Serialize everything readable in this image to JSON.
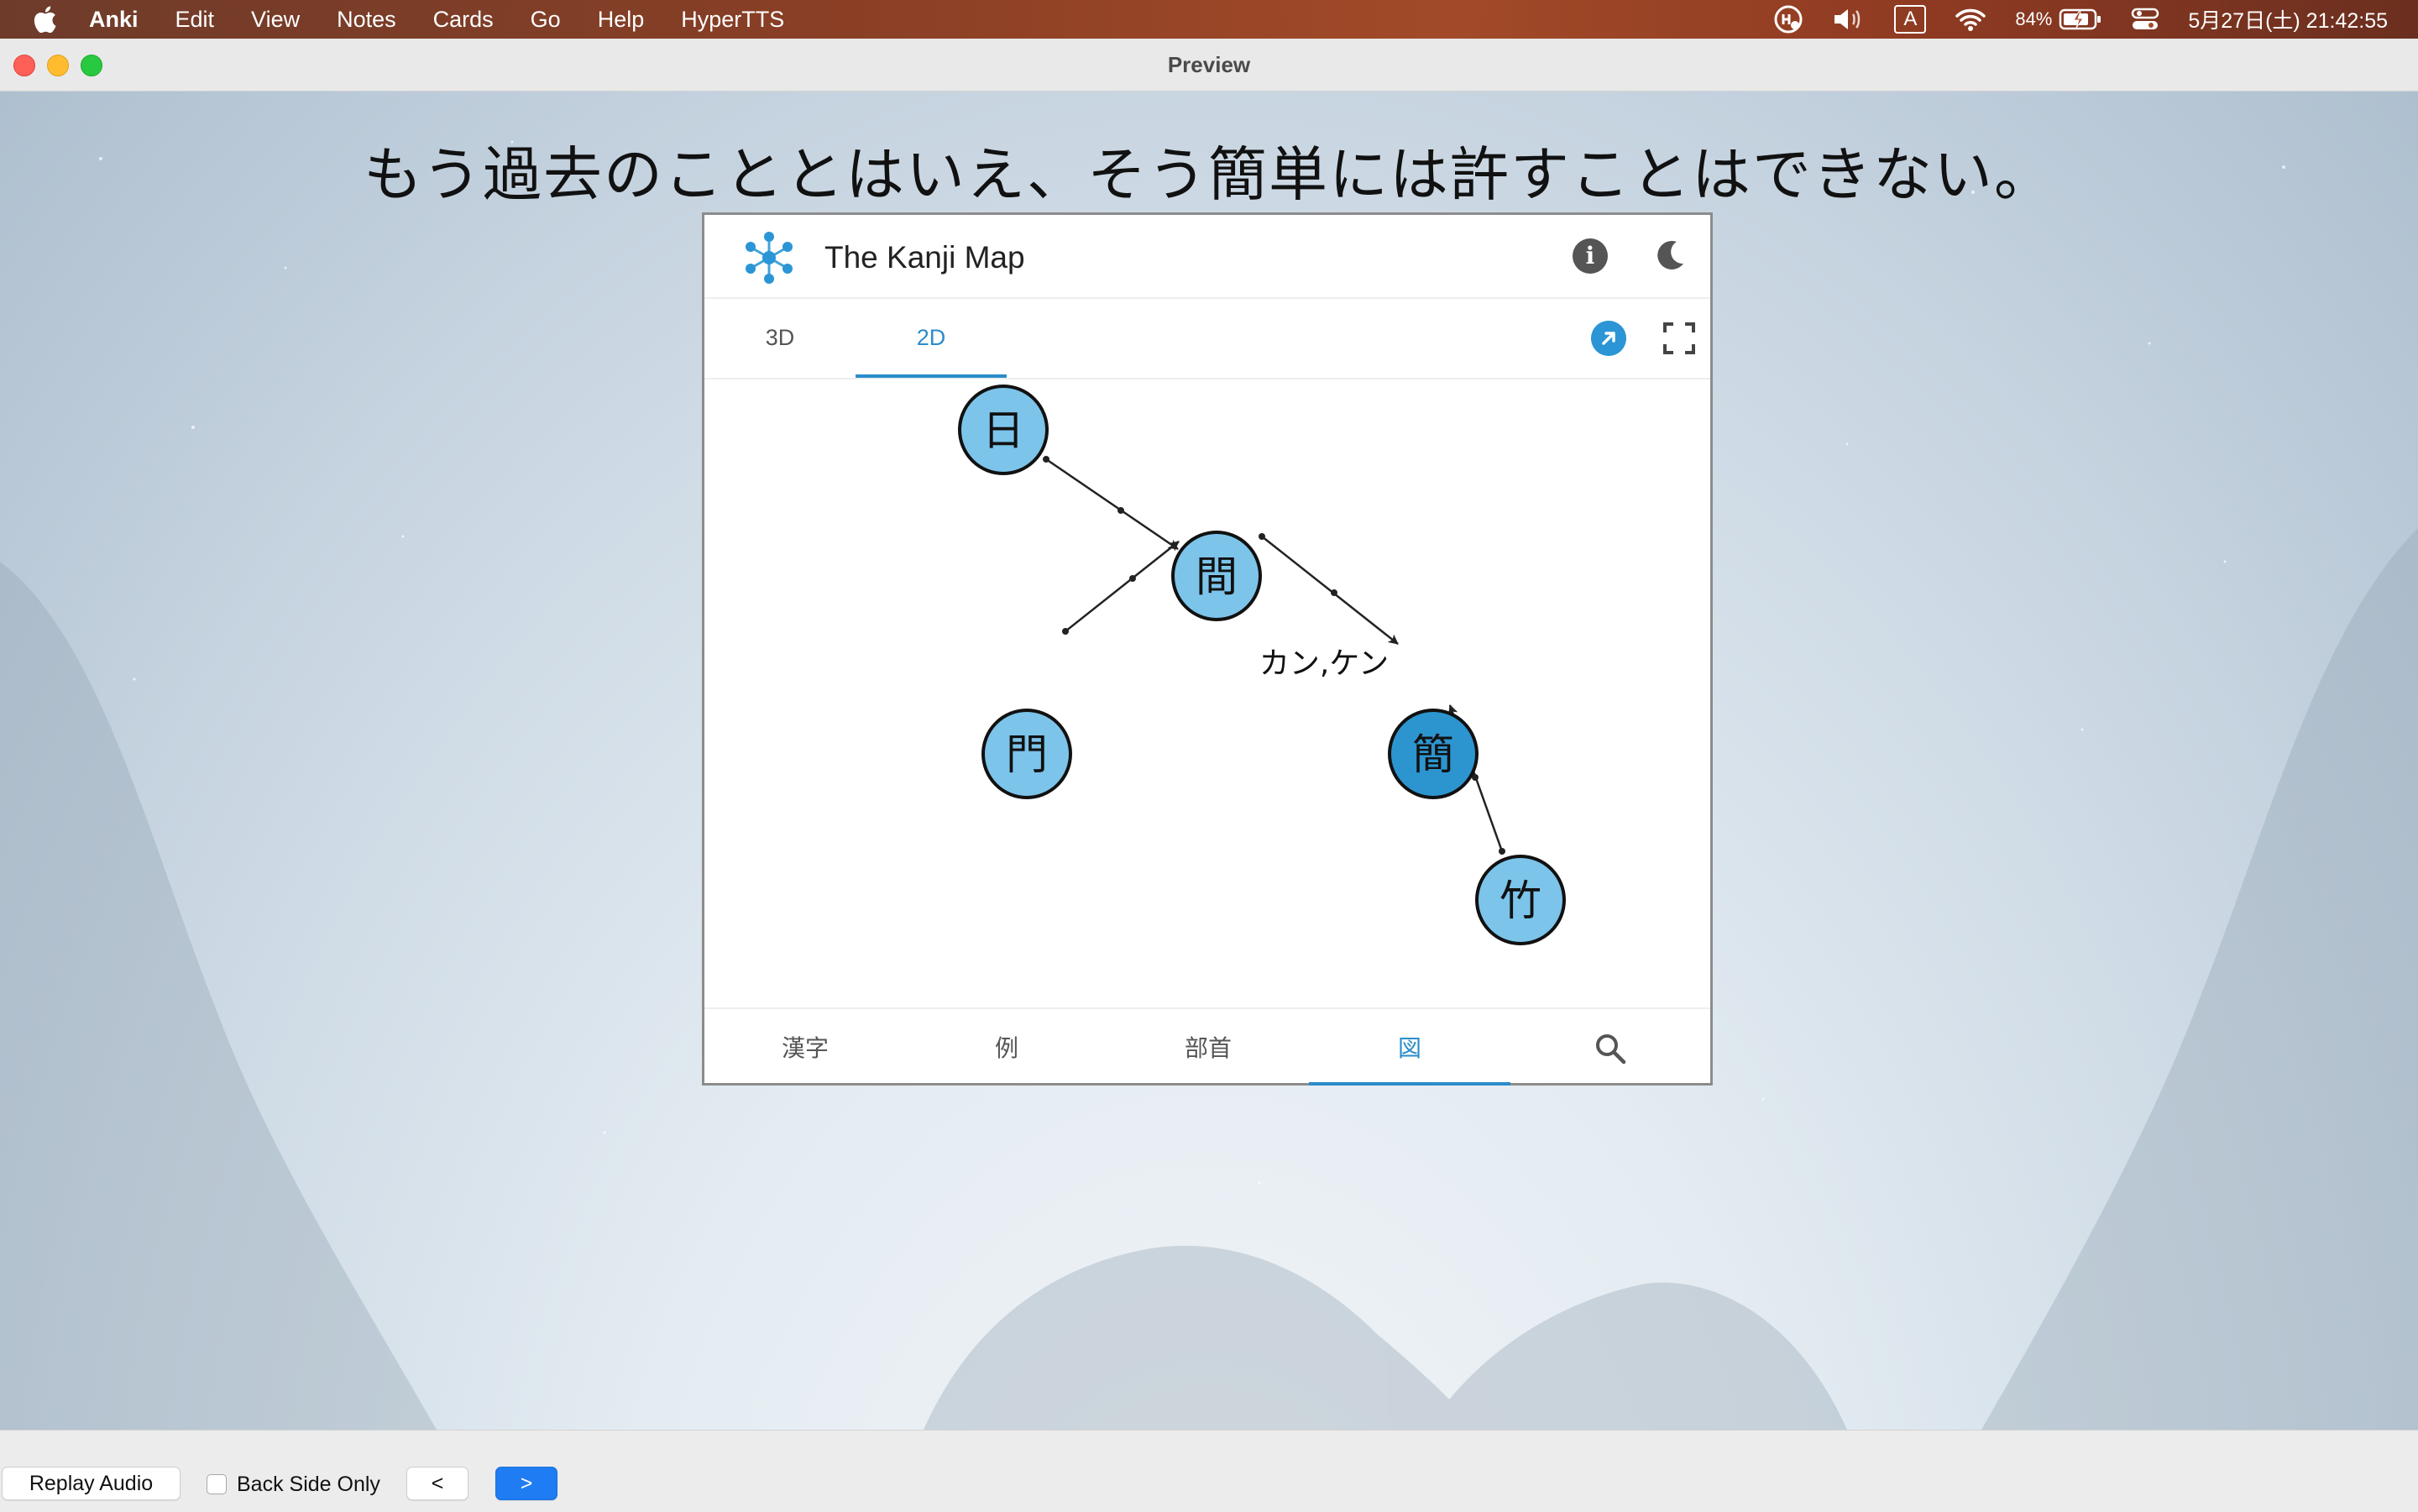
{
  "menubar": {
    "app_name": "Anki",
    "items": [
      "Edit",
      "View",
      "Notes",
      "Cards",
      "Go",
      "Help",
      "HyperTTS"
    ],
    "input_source": "A",
    "battery": "84%",
    "datetime": "5月27日(土) 21:42:55",
    "icons": [
      "apple-icon",
      "hypertts-status-icon",
      "volume-icon",
      "input-source-icon",
      "wifi-icon",
      "battery-icon",
      "control-center-icon"
    ]
  },
  "window": {
    "title": "Preview"
  },
  "card": {
    "sentence": "もう過去のこととはいえ、そう簡単には許すことはできない。"
  },
  "kanji_map": {
    "title": "The Kanji Map",
    "top_tabs": [
      "3D",
      "2D"
    ],
    "active_top_tab": "2D",
    "bottom_tabs": [
      "漢字",
      "例",
      "部首",
      "図"
    ],
    "active_bottom_tab": "図",
    "accent_color": "#2b8ccb",
    "node_color": "#7cc4ea",
    "highlight_node_color": "#2c95cf",
    "graph": {
      "nodes": [
        "日",
        "間",
        "門",
        "簡",
        "竹"
      ],
      "highlighted": "簡",
      "edges": [
        {
          "from": "日",
          "to": "間"
        },
        {
          "from": "門",
          "to": "間"
        },
        {
          "from": "間",
          "to": "簡"
        },
        {
          "from": "竹",
          "to": "簡"
        }
      ],
      "reading_label": "カン,ケン"
    }
  },
  "footer": {
    "replay_audio": "Replay Audio",
    "back_side_only": "Back Side Only",
    "back_side_only_checked": false,
    "prev_label": "<",
    "next_label": ">"
  }
}
